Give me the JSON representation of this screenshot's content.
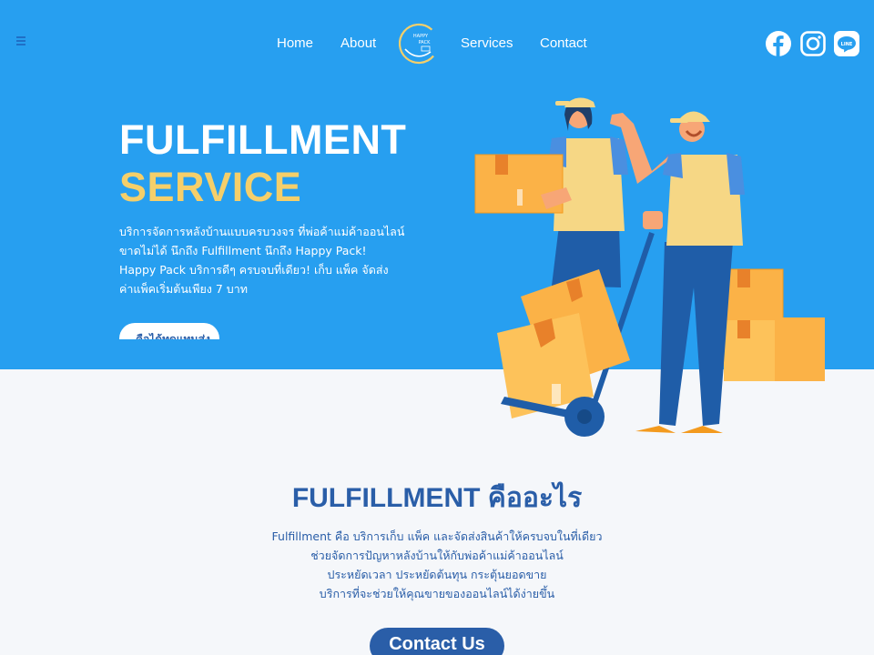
{
  "nav": {
    "menu_icon": "hamburger-icon",
    "links": [
      "Home",
      "About",
      "Services",
      "Contact"
    ],
    "logo_text": [
      "HAPPY",
      "PACK"
    ],
    "social": [
      "facebook-icon",
      "instagram-icon",
      "line-icon"
    ],
    "line_text": "LINE"
  },
  "hero": {
    "title_line1": "FULFILLMENT",
    "title_line2": "SERVICE",
    "description": [
      "บริการจัดการหลังบ้านแบบครบวงจร ที่พ่อค้าแม่ค้าออนไลน์",
      "ขาดไม่ได้ นึกถึง Fulfillment นึกถึง Happy Pack!",
      "Happy Pack บริการดีๆ ครบจบที่เดียว! เก็บ แพ็ค จัดส่ง",
      "ค่าแพ็คเริ่มต้นเพียง 7 บาท"
    ],
    "cta_label": "คือได้ทดแทนส่ง"
  },
  "about": {
    "title": "FULFILLMENT คืออะไร",
    "body": [
      "Fulfillment คือ บริการเก็บ แพ็ค และจัดส่งสินค้าให้ครบจบในที่เดียว",
      "ช่วยจัดการปัญหาหลังบ้านให้กับพ่อค้าแม่ค้าออนไลน์",
      "ประหยัดเวลา ประหยัดต้นทุน กระตุ้นยอดขาย",
      "บริการที่จะช่วยให้คุณขายของออนไลน์ได้ง่ายขึ้น"
    ],
    "contact_label": "Contact Us"
  },
  "colors": {
    "hero_bg": "#279ff0",
    "accent_yellow": "#f5cf6a",
    "brand_blue": "#2a5ea8",
    "page_bg": "#f5f7fa"
  }
}
